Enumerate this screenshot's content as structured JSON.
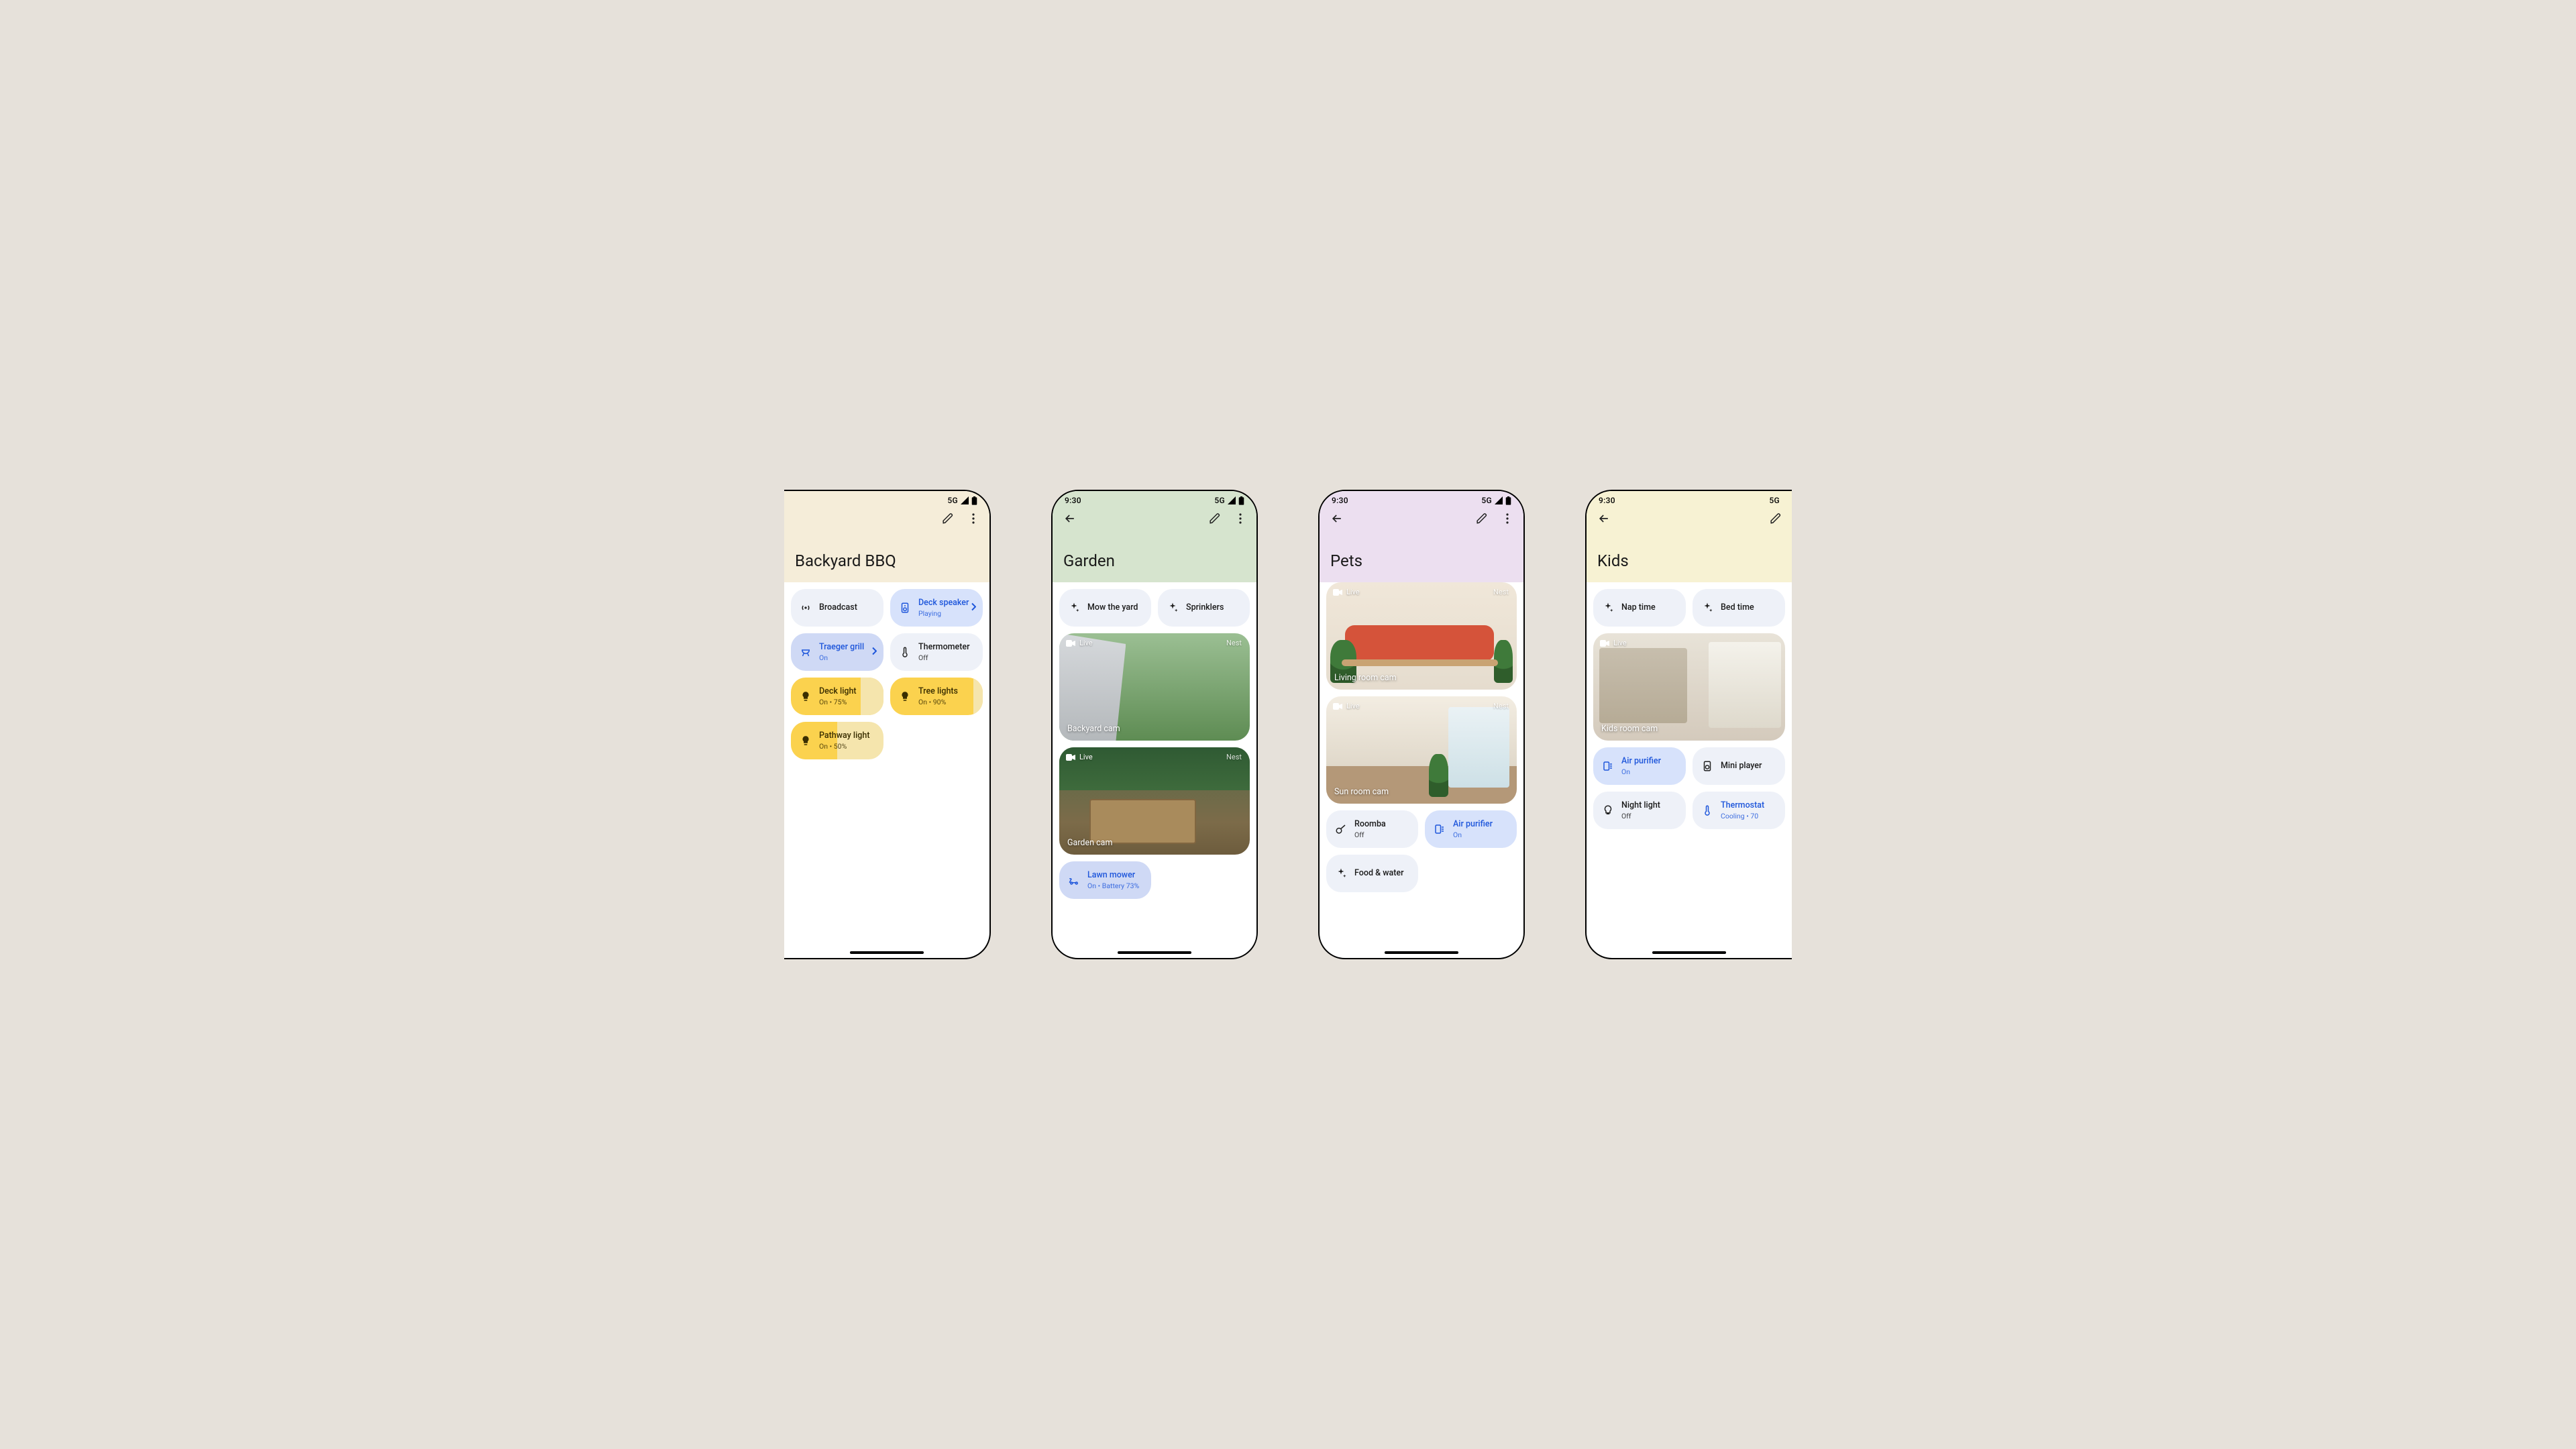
{
  "status": {
    "time": "9:30",
    "network": "5G"
  },
  "cam_ui": {
    "live": "Live",
    "brand": "Nest"
  },
  "phone1": {
    "header": {
      "bg": "#f5edd9",
      "title": "Backyard BBQ"
    },
    "tiles": {
      "broadcast": {
        "label": "Broadcast"
      },
      "speaker": {
        "label": "Deck speaker",
        "sub": "Playing"
      },
      "grill": {
        "label": "Traeger grill",
        "sub": "On"
      },
      "thermo": {
        "label": "Thermometer",
        "sub": "Off"
      },
      "deck": {
        "label": "Deck light",
        "sub": "On • 75%"
      },
      "tree": {
        "label": "Tree lights",
        "sub": "On • 90%"
      },
      "path": {
        "label": "Pathway light",
        "sub": "On • 50%"
      }
    }
  },
  "phone2": {
    "header": {
      "bg": "#d6e4ce",
      "title": "Garden"
    },
    "tiles": {
      "mow": {
        "label": "Mow the yard"
      },
      "sprinklers": {
        "label": "Sprinklers"
      },
      "mower": {
        "label": "Lawn mower",
        "sub": "On • Battery 73%"
      }
    },
    "cams": {
      "backyard": {
        "name": "Backyard cam"
      },
      "garden": {
        "name": "Garden cam"
      }
    }
  },
  "phone3": {
    "header": {
      "bg": "#ecdff0",
      "title": "Pets"
    },
    "tiles": {
      "roomba": {
        "label": "Roomba",
        "sub": "Off"
      },
      "purifier": {
        "label": "Air purifier",
        "sub": "On"
      },
      "food": {
        "label": "Food & water"
      }
    },
    "cams": {
      "living": {
        "name": "Living room cam"
      },
      "sunroom": {
        "name": "Sun room cam"
      }
    }
  },
  "phone4": {
    "header": {
      "bg": "#f7f2d3",
      "title": "Kids"
    },
    "tiles": {
      "nap": {
        "label": "Nap time"
      },
      "bed": {
        "label": "Bed time"
      },
      "purifier": {
        "label": "Air purifier",
        "sub": "On"
      },
      "mini": {
        "label": "Mini player"
      },
      "night": {
        "label": "Night light",
        "sub": "Off"
      },
      "thermo": {
        "label": "Thermostat",
        "sub": "Cooling • 70"
      }
    },
    "cams": {
      "kids": {
        "name": "Kids room cam"
      }
    }
  }
}
